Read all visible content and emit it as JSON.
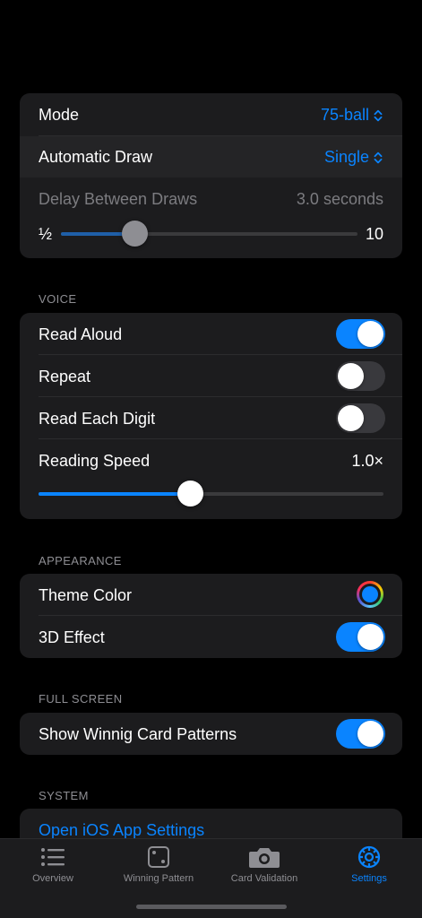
{
  "colors": {
    "accent": "#0a84ff",
    "background": "#000000",
    "cell": "#1c1c1e"
  },
  "draw": {
    "mode_label": "Mode",
    "mode_value": "75-ball",
    "auto_draw_label": "Automatic Draw",
    "auto_draw_value": "Single",
    "delay_label": "Delay Between Draws",
    "delay_value": "3.0 seconds",
    "delay_min_label": "½",
    "delay_max_label": "10",
    "delay_slider_fraction": 0.25
  },
  "voice": {
    "section_title": "VOICE",
    "read_aloud_label": "Read Aloud",
    "read_aloud_on": true,
    "repeat_label": "Repeat",
    "repeat_on": false,
    "read_each_digit_label": "Read Each Digit",
    "read_each_digit_on": false,
    "reading_speed_label": "Reading Speed",
    "reading_speed_value": "1.0×",
    "reading_speed_fraction": 0.44
  },
  "appearance": {
    "section_title": "APPEARANCE",
    "theme_color_label": "Theme Color",
    "theme_color_value": "#0a84ff",
    "effect_3d_label": "3D Effect",
    "effect_3d_on": true
  },
  "full_screen": {
    "section_title": "FULL SCREEN",
    "show_patterns_label": "Show Winnig Card Patterns",
    "show_patterns_on": true
  },
  "system": {
    "section_title": "SYSTEM",
    "open_settings_label": "Open iOS App Settings"
  },
  "tabs": [
    {
      "label": "Overview",
      "icon": "list-icon",
      "active": false
    },
    {
      "label": "Winning Pattern",
      "icon": "dice-icon",
      "active": false
    },
    {
      "label": "Card Validation",
      "icon": "camera-icon",
      "active": false
    },
    {
      "label": "Settings",
      "icon": "gear-icon",
      "active": true
    }
  ]
}
